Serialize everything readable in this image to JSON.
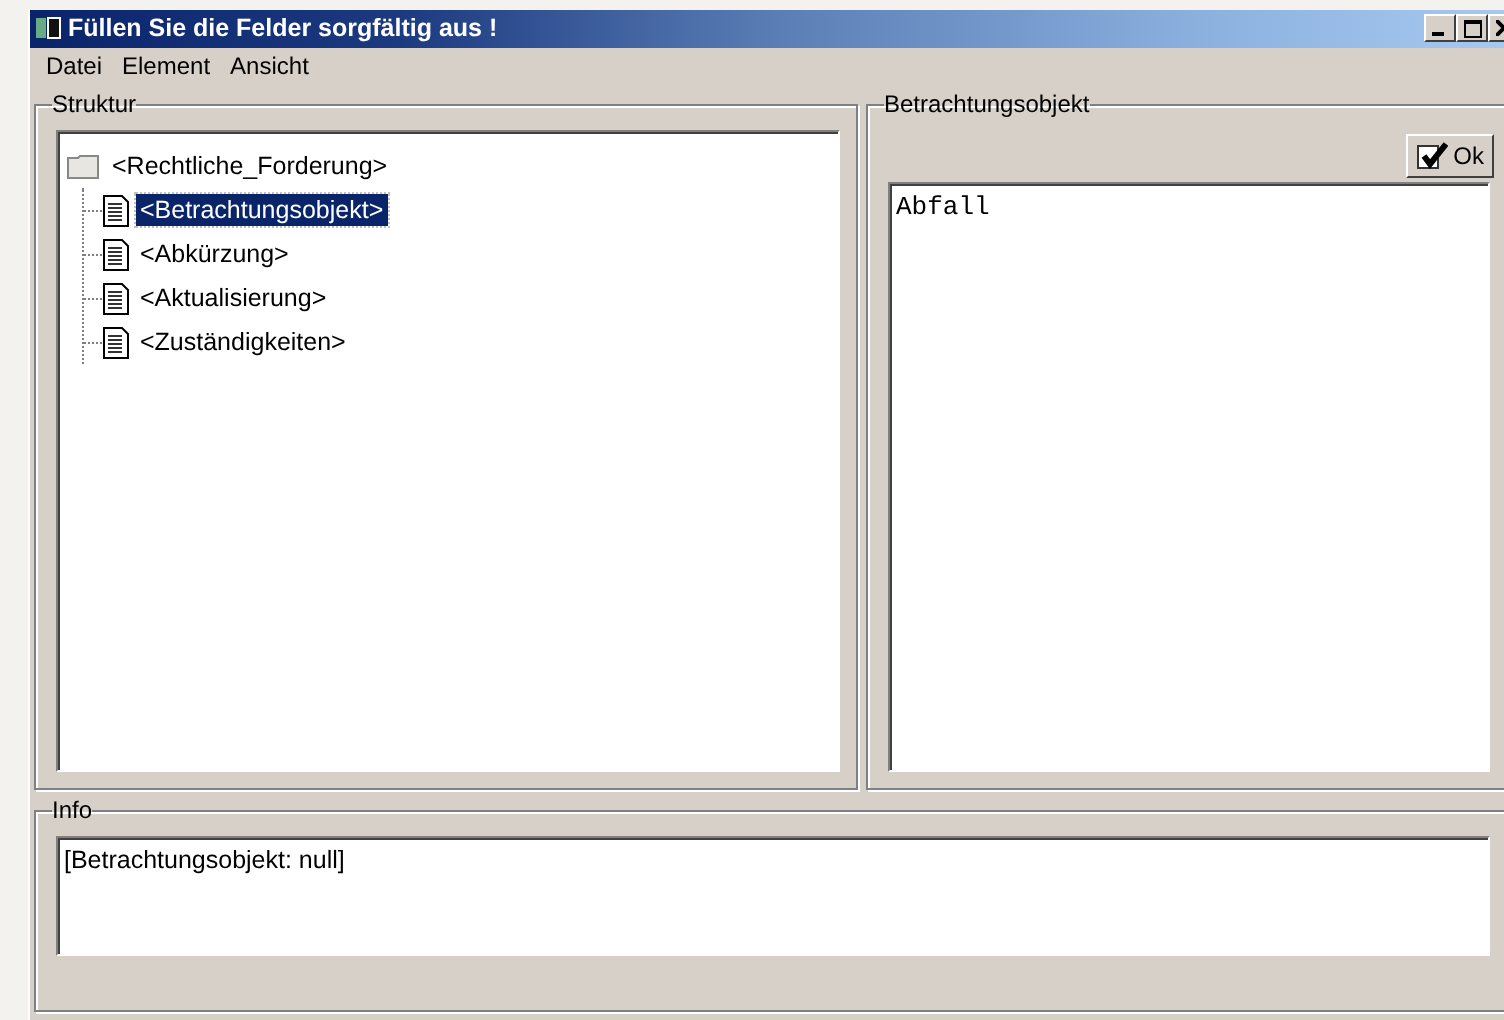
{
  "window": {
    "title": "Füllen Sie die Felder sorgfältig aus !"
  },
  "menu": [
    "Datei",
    "Element",
    "Ansicht"
  ],
  "structure": {
    "title": "Struktur",
    "tree": [
      {
        "label": "<Rechtliche_Forderung>",
        "selected": false,
        "children": [
          {
            "label": "<Betrachtungsobjekt>",
            "selected": true
          },
          {
            "label": "<Abkürzung>",
            "selected": false
          },
          {
            "label": "<Aktualisierung>",
            "selected": false
          },
          {
            "label": "<Zuständigkeiten>",
            "selected": false
          }
        ]
      }
    ]
  },
  "editor": {
    "title": "Betrachtungsobjekt",
    "ok_button": "Ok",
    "value": "Abfall"
  },
  "info": {
    "title": "Info",
    "text": "[Betrachtungsobjekt: null]"
  }
}
